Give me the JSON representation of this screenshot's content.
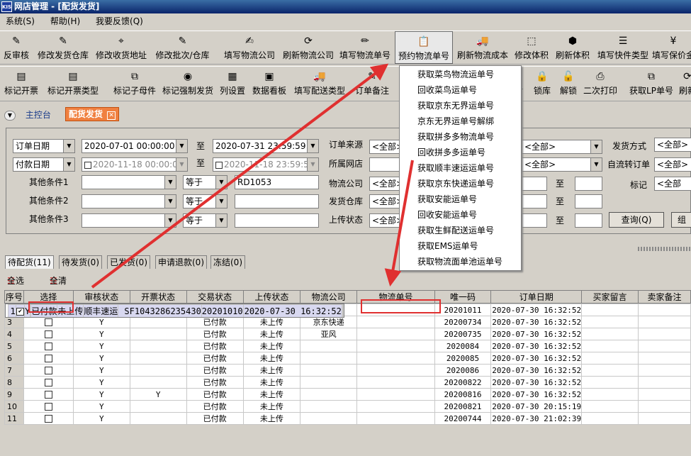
{
  "window": {
    "title": "网店管理 - [配货发货]",
    "app_icon": "KIS"
  },
  "menu": [
    "系统(S)",
    "帮助(H)",
    "我要反馈(Q)"
  ],
  "toolbar1": [
    {
      "label": "反审核",
      "icon": "review-icon"
    },
    {
      "label": "修改发货仓库",
      "icon": "edit-icon"
    },
    {
      "label": "修改收货地址",
      "icon": "pin-icon"
    },
    {
      "label": "修改批次/仓库",
      "icon": "batch-icon"
    },
    {
      "label": "填写物流公司",
      "icon": "write-icon"
    },
    {
      "label": "刷新物流公司",
      "icon": "refresh-icon"
    },
    {
      "label": "填写物流单号",
      "icon": "pencil-icon"
    },
    {
      "label": "预约物流单号",
      "icon": "reserve-icon"
    },
    {
      "label": "刷新物流成本",
      "icon": "truck-icon"
    },
    {
      "label": "修改体积",
      "icon": "box-icon"
    },
    {
      "label": "刷新体积",
      "icon": "cube-icon"
    },
    {
      "label": "填写快件类型",
      "icon": "list-icon"
    },
    {
      "label": "填写保价金",
      "icon": "money-icon"
    }
  ],
  "toolbar2": [
    {
      "label": "标记开票",
      "icon": "invoice-icon"
    },
    {
      "label": "标记开票类型",
      "icon": "invoice-type-icon"
    },
    {
      "label": "标记子母件",
      "icon": "child-icon"
    },
    {
      "label": "标记强制发货",
      "icon": "force-icon"
    },
    {
      "label": "列设置",
      "icon": "columns-icon"
    },
    {
      "label": "数据看板",
      "icon": "board-icon"
    },
    {
      "label": "填写配送类型",
      "icon": "delivery-icon"
    },
    {
      "label": "订单备注",
      "icon": "note-icon"
    },
    {
      "label": "锁库",
      "icon": "lock-icon"
    },
    {
      "label": "解锁",
      "icon": "unlock-icon"
    },
    {
      "label": "二次打印",
      "icon": "print-icon"
    },
    {
      "label": "获取LP单号",
      "icon": "lp-icon"
    },
    {
      "label": "刷新",
      "icon": "refresh2-icon"
    }
  ],
  "toolbar2_extra": "片",
  "tabs": {
    "home": "主控台",
    "active": "配货发货"
  },
  "filters": {
    "date_type1": "订单日期",
    "date_from1": "2020-07-01 00:00:00",
    "to": "至",
    "date_to1": "2020-07-31 23:59:59",
    "date_type2": "付款日期",
    "date_from2": "2020-11-18 00:00:00",
    "date_to2": "2020-11-18 23:59:59",
    "cond1_label": "其他条件1",
    "cond2_label": "其他条件2",
    "cond3_label": "其他条件3",
    "op1": "等于",
    "op2": "等于",
    "op3": "等于",
    "cond1_value": "RD1053",
    "order_source_label": "订单来源",
    "order_source": "<全部>",
    "shop_label": "所属网店",
    "logistics_label": "物流公司",
    "logistics": "<全部>",
    "warehouse_label": "发货仓库",
    "warehouse": "<全部>",
    "upload_label": "上传状态",
    "upload": "<全部>",
    "sel_a": "<全部>",
    "sel_b": "<全部>",
    "ship_method_label": "发货方式",
    "ship_method": "<全部>",
    "auto_label": "自流转订单",
    "auto": "<全部>",
    "mark_label": "标记",
    "mark": "<全部",
    "query_button": "查询(Q)",
    "group_button": "组"
  },
  "dropdown": [
    "获取菜鸟物流运单号",
    "回收菜鸟运单号",
    "获取京东无界运单号",
    "京东无界运单号解绑",
    "获取拼多多物流单号",
    "回收拼多多运单号",
    "获取顺丰速运运单号",
    "获取京东快递运单号",
    "获取安能运单号",
    "回收安能运单号",
    "获取生鲜配送运单号",
    "获取EMS运单号",
    "获取物流面单池运单号"
  ],
  "subtabs": [
    "待配货(11)",
    "待发货(0)",
    "已发货(0)",
    "申请退款(0)",
    "冻结(0)"
  ],
  "select_all": "全选",
  "clear_all": "全清",
  "columns": [
    "序号",
    "选择",
    "审核状态",
    "开票状态",
    "交易状态",
    "上传状态",
    "物流公司",
    "物流单号",
    "唯一码",
    "订单日期",
    "买家留言",
    "卖家备注"
  ],
  "rows": [
    {
      "idx": "1",
      "checked": true,
      "audit": "Y",
      "invoice": "",
      "trade": "已付款",
      "upload": "未上传",
      "carrier": "顺丰速运",
      "tracking": "SF1043286235430",
      "code": "20201010",
      "date": "2020-07-30 16:32:52"
    },
    {
      "idx": "2",
      "checked": false,
      "audit": "Y",
      "invoice": "",
      "trade": "已付款",
      "upload": "未上传",
      "carrier": "顺丰速运",
      "tracking": "",
      "code": "20201011",
      "date": "2020-07-30 16:32:52"
    },
    {
      "idx": "3",
      "checked": false,
      "audit": "Y",
      "invoice": "",
      "trade": "已付款",
      "upload": "未上传",
      "carrier": "京东快递",
      "tracking": "",
      "code": "20200734",
      "date": "2020-07-30 16:32:52"
    },
    {
      "idx": "4",
      "checked": false,
      "audit": "Y",
      "invoice": "",
      "trade": "已付款",
      "upload": "未上传",
      "carrier": "亚风",
      "tracking": "",
      "code": "20200735",
      "date": "2020-07-30 16:32:52"
    },
    {
      "idx": "5",
      "checked": false,
      "audit": "Y",
      "invoice": "",
      "trade": "已付款",
      "upload": "未上传",
      "carrier": "",
      "tracking": "",
      "code": "2020084",
      "date": "2020-07-30 16:32:52"
    },
    {
      "idx": "6",
      "checked": false,
      "audit": "Y",
      "invoice": "",
      "trade": "已付款",
      "upload": "未上传",
      "carrier": "",
      "tracking": "",
      "code": "2020085",
      "date": "2020-07-30 16:32:52"
    },
    {
      "idx": "7",
      "checked": false,
      "audit": "Y",
      "invoice": "",
      "trade": "已付款",
      "upload": "未上传",
      "carrier": "",
      "tracking": "",
      "code": "2020086",
      "date": "2020-07-30 16:32:52"
    },
    {
      "idx": "8",
      "checked": false,
      "audit": "Y",
      "invoice": "",
      "trade": "已付款",
      "upload": "未上传",
      "carrier": "",
      "tracking": "",
      "code": "20200822",
      "date": "2020-07-30 16:32:52"
    },
    {
      "idx": "9",
      "checked": false,
      "audit": "Y",
      "invoice": "Y",
      "trade": "已付款",
      "upload": "未上传",
      "carrier": "",
      "tracking": "",
      "code": "20200816",
      "date": "2020-07-30 16:32:52"
    },
    {
      "idx": "10",
      "checked": false,
      "audit": "Y",
      "invoice": "",
      "trade": "已付款",
      "upload": "未上传",
      "carrier": "",
      "tracking": "",
      "code": "20200821",
      "date": "2020-07-30 20:15:19"
    },
    {
      "idx": "11",
      "checked": false,
      "audit": "Y",
      "invoice": "",
      "trade": "已付款",
      "upload": "未上传",
      "carrier": "",
      "tracking": "",
      "code": "20200744",
      "date": "2020-07-30 21:02:39"
    }
  ],
  "accent": "#e03030"
}
